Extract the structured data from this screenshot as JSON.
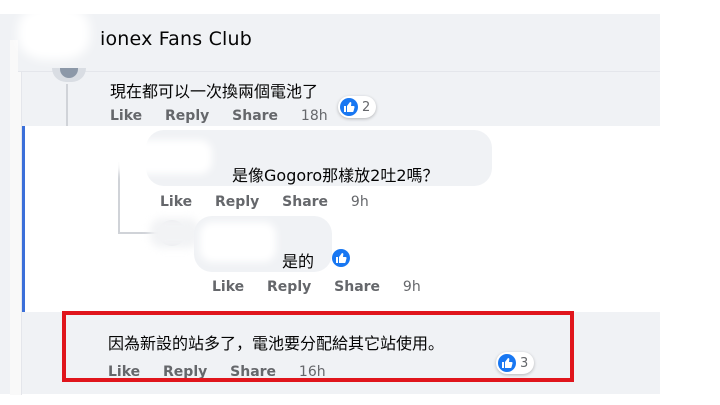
{
  "header": {
    "title": "ionex Fans Club"
  },
  "actions": {
    "like": "Like",
    "reply": "Reply",
    "share": "Share"
  },
  "comments": [
    {
      "text": "現在都可以一次換兩個電池了",
      "time": "18h",
      "reactions": "2"
    },
    {
      "text": "是像Gogoro那樣放2吐2嗎？",
      "time": "9h",
      "reactions": ""
    },
    {
      "text": "是的",
      "time": "9h",
      "reactions": ""
    },
    {
      "text": "因為新設的站多了，電池要分配給其它站使用。",
      "time": "16h",
      "reactions": "3"
    }
  ],
  "colors": {
    "highlight": "#e0151c",
    "like_blue": "#1877f2",
    "bubble": "#f0f2f5",
    "muted": "#65676b"
  },
  "icons": [
    "like-icon",
    "avatar"
  ]
}
